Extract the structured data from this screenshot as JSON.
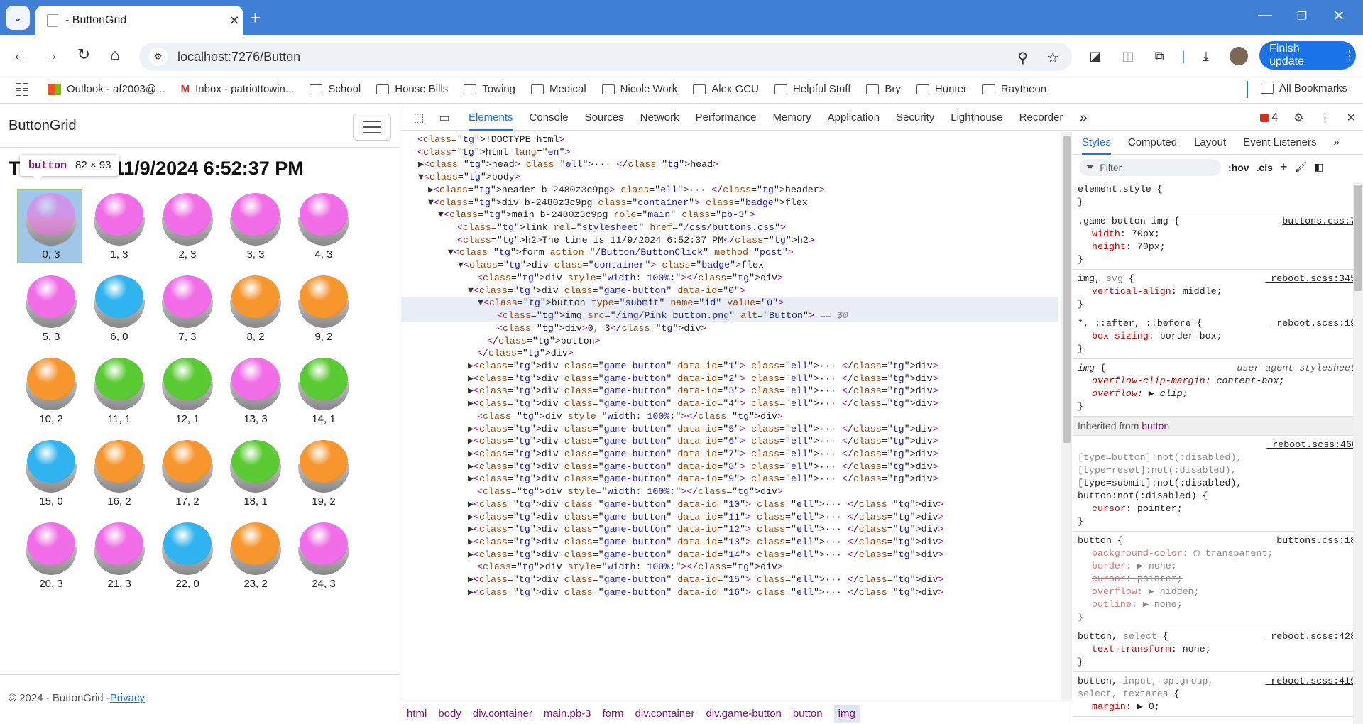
{
  "browser": {
    "tab_title": "- ButtonGrid",
    "url": "localhost:7276/Button",
    "finish_update_label": "Finish update",
    "bookmarks": [
      "Outlook - af2003@...",
      "Inbox - patriottowin...",
      "School",
      "House Bills",
      "Towing",
      "Medical",
      "Nicole Work",
      "Alex GCU",
      "Helpful Stuff",
      "Bry",
      "Hunter",
      "Raytheon"
    ],
    "all_bookmarks_label": "All Bookmarks"
  },
  "page": {
    "brand": "ButtonGrid",
    "heading": "The time is 11/9/2024 6:52:37 PM",
    "tooltip_tag": "button",
    "tooltip_size": "82 × 93",
    "footer_text": "© 2024 - ButtonGrid -",
    "footer_link": "Privacy",
    "colors": {
      "pink": "#f26ee8",
      "blue": "#2fb4f0",
      "orange": "#f8962e",
      "green": "#5acb32"
    },
    "buttons": [
      {
        "label": "0, 3",
        "color": "pink"
      },
      {
        "label": "1, 3",
        "color": "pink"
      },
      {
        "label": "2, 3",
        "color": "pink"
      },
      {
        "label": "3, 3",
        "color": "pink"
      },
      {
        "label": "4, 3",
        "color": "pink"
      },
      {
        "label": "5, 3",
        "color": "pink"
      },
      {
        "label": "6, 0",
        "color": "blue"
      },
      {
        "label": "7, 3",
        "color": "pink"
      },
      {
        "label": "8, 2",
        "color": "orange"
      },
      {
        "label": "9, 2",
        "color": "orange"
      },
      {
        "label": "10, 2",
        "color": "orange"
      },
      {
        "label": "11, 1",
        "color": "green"
      },
      {
        "label": "12, 1",
        "color": "green"
      },
      {
        "label": "13, 3",
        "color": "pink"
      },
      {
        "label": "14, 1",
        "color": "green"
      },
      {
        "label": "15, 0",
        "color": "blue"
      },
      {
        "label": "16, 2",
        "color": "orange"
      },
      {
        "label": "17, 2",
        "color": "orange"
      },
      {
        "label": "18, 1",
        "color": "green"
      },
      {
        "label": "19, 2",
        "color": "orange"
      },
      {
        "label": "20, 3",
        "color": "pink"
      },
      {
        "label": "21, 3",
        "color": "pink"
      },
      {
        "label": "22, 0",
        "color": "blue"
      },
      {
        "label": "23, 2",
        "color": "orange"
      },
      {
        "label": "24, 3",
        "color": "pink"
      }
    ]
  },
  "devtools": {
    "tabs": [
      "Elements",
      "Console",
      "Sources",
      "Network",
      "Performance",
      "Memory",
      "Application",
      "Security",
      "Lighthouse",
      "Recorder"
    ],
    "more_tabs": "»",
    "error_count": "4",
    "dom_lines": [
      "<!DOCTYPE html>",
      "<html lang=\"en\">",
      "▶<head> … </head>",
      "▼<body>",
      "▶<header b-2480z3c9pg> … </header>",
      "▼<div b-2480z3c9pg class=\"container\"> flex",
      "▼<main b-2480z3c9pg role=\"main\" class=\"pb-3\">",
      "<link rel=\"stylesheet\" href=\"/css/buttons.css\">",
      "<h2>The time is 11/9/2024 6:52:37 PM</h2>",
      "▼<form action=\"/Button/ButtonClick\" method=\"post\">",
      "▼<div class=\"container\"> flex",
      "<div style=\"width: 100%;\"></div>",
      "▼<div class=\"game-button\" data-id=\"0\">",
      "▼<button type=\"submit\" name=\"id\" value=\"0\">",
      "<img src=\"/img/Pink_button.png\" alt=\"Button\"> == $0",
      "<div>0, 3</div>",
      "</button>",
      "</div>",
      "▶<div class=\"game-button\" data-id=\"1\"> … </div>",
      "▶<div class=\"game-button\" data-id=\"2\"> … </div>",
      "▶<div class=\"game-button\" data-id=\"3\"> … </div>",
      "▶<div class=\"game-button\" data-id=\"4\"> … </div>",
      "<div style=\"width: 100%;\"></div>",
      "▶<div class=\"game-button\" data-id=\"5\"> … </div>",
      "▶<div class=\"game-button\" data-id=\"6\"> … </div>",
      "▶<div class=\"game-button\" data-id=\"7\"> … </div>",
      "▶<div class=\"game-button\" data-id=\"8\"> … </div>",
      "▶<div class=\"game-button\" data-id=\"9\"> … </div>",
      "<div style=\"width: 100%;\"></div>",
      "▶<div class=\"game-button\" data-id=\"10\"> … </div>",
      "▶<div class=\"game-button\" data-id=\"11\"> … </div>",
      "▶<div class=\"game-button\" data-id=\"12\"> … </div>",
      "▶<div class=\"game-button\" data-id=\"13\"> … </div>",
      "▶<div class=\"game-button\" data-id=\"14\"> … </div>",
      "<div style=\"width: 100%;\"></div>",
      "▶<div class=\"game-button\" data-id=\"15\"> … </div>",
      "▶<div class=\"game-button\" data-id=\"16\"> … </div>"
    ],
    "breadcrumbs": [
      "html",
      "body",
      "div.container",
      "main.pb-3",
      "form",
      "div.container",
      "div.game-button",
      "button",
      "img"
    ],
    "styles_tabs": [
      "Styles",
      "Computed",
      "Layout",
      "Event Listeners"
    ],
    "filter_placeholder": "Filter",
    "hov": ":hov",
    "cls": ".cls",
    "inherited_label": "Inherited from",
    "inherited_from": "button"
  }
}
